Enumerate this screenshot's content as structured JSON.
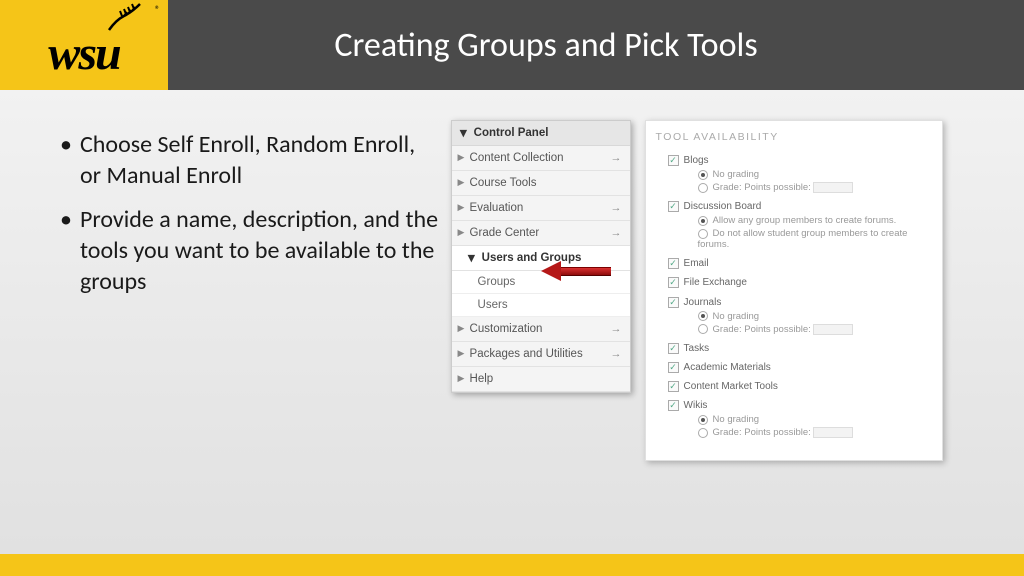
{
  "header": {
    "logo_text": "wsu",
    "reg_mark": "®",
    "title": "Creating Groups and Pick Tools"
  },
  "bullets": [
    "Choose Self Enroll, Random Enroll, or Manual Enroll",
    "Provide a name, description, and the tools you want to be available to the groups"
  ],
  "control_panel": {
    "title": "Control Panel",
    "rows": [
      {
        "label": "Content Collection",
        "has_arrow": true
      },
      {
        "label": "Course Tools",
        "has_arrow": false
      },
      {
        "label": "Evaluation",
        "has_arrow": true
      },
      {
        "label": "Grade Center",
        "has_arrow": true
      }
    ],
    "section": "Users and Groups",
    "subs": [
      "Groups",
      "Users"
    ],
    "rows2": [
      {
        "label": "Customization",
        "has_arrow": true
      },
      {
        "label": "Packages and Utilities",
        "has_arrow": true
      },
      {
        "label": "Help",
        "has_arrow": false
      }
    ]
  },
  "tool_availability": {
    "title": "TOOL AVAILABILITY",
    "items": [
      {
        "label": "Blogs",
        "subs": [
          {
            "type": "radio",
            "selected": true,
            "text": "No grading"
          },
          {
            "type": "radio",
            "selected": false,
            "text": "Grade: Points possible:",
            "input": true
          }
        ]
      },
      {
        "label": "Discussion Board",
        "subs": [
          {
            "type": "radio",
            "selected": true,
            "text": "Allow any group members to create forums."
          },
          {
            "type": "radio",
            "selected": false,
            "text": "Do not allow student group members to create forums."
          }
        ]
      },
      {
        "label": "Email"
      },
      {
        "label": "File Exchange"
      },
      {
        "label": "Journals",
        "subs": [
          {
            "type": "radio",
            "selected": true,
            "text": "No grading"
          },
          {
            "type": "radio",
            "selected": false,
            "text": "Grade: Points possible:",
            "input": true
          }
        ]
      },
      {
        "label": "Tasks"
      },
      {
        "label": "Academic Materials"
      },
      {
        "label": "Content Market Tools"
      },
      {
        "label": "Wikis",
        "subs": [
          {
            "type": "radio",
            "selected": true,
            "text": "No grading"
          },
          {
            "type": "radio",
            "selected": false,
            "text": "Grade: Points possible:",
            "input": true
          }
        ]
      }
    ]
  }
}
